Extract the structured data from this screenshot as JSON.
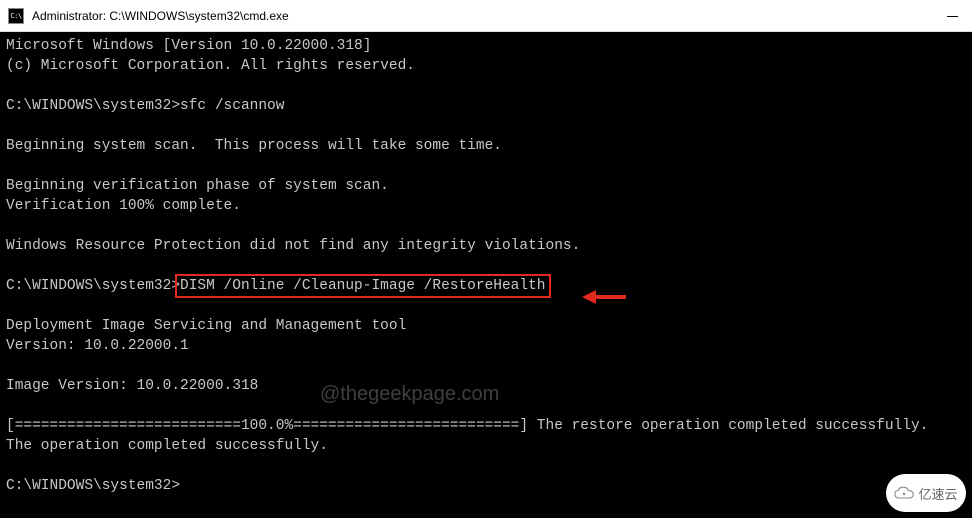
{
  "titlebar": {
    "icon_label": "C:\\",
    "title": "Administrator: C:\\WINDOWS\\system32\\cmd.exe"
  },
  "terminal": {
    "line_version": "Microsoft Windows [Version 10.0.22000.318]",
    "line_copyright": "(c) Microsoft Corporation. All rights reserved.",
    "prompt1_path": "C:\\WINDOWS\\system32>",
    "prompt1_cmd": "sfc /scannow",
    "line_scan_begin": "Beginning system scan.  This process will take some time.",
    "line_verify_phase": "Beginning verification phase of system scan.",
    "line_verify_complete": "Verification 100% complete.",
    "line_wrp_result": "Windows Resource Protection did not find any integrity violations.",
    "prompt2_path": "C:\\WINDOWS\\system32>",
    "prompt2_cmd": "DISM /Online /Cleanup-Image /RestoreHealth",
    "line_dism_tool": "Deployment Image Servicing and Management tool",
    "line_dism_version": "Version: 10.0.22000.1",
    "line_image_version": "Image Version: 10.0.22000.318",
    "line_progress": "[==========================100.0%==========================] The restore operation completed successfully.",
    "line_op_complete": "The operation completed successfully.",
    "prompt3_path": "C:\\WINDOWS\\system32>"
  },
  "watermark": "@thegeekpage.com",
  "badge": "亿速云"
}
